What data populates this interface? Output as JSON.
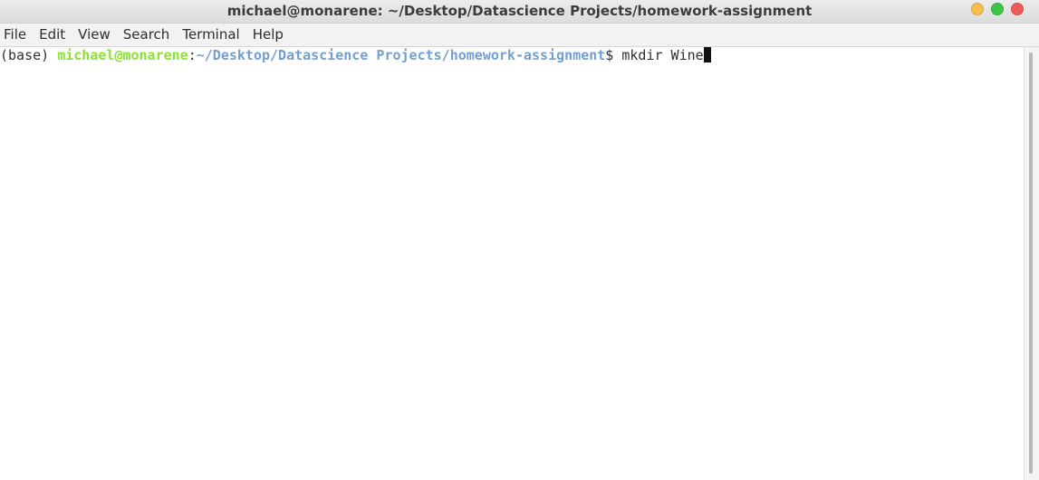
{
  "window": {
    "title": "michael@monarene: ~/Desktop/Datascience Projects/homework-assignment",
    "controls": [
      {
        "name": "minimize",
        "color": "#f4bf4f"
      },
      {
        "name": "maximize",
        "color": "#3cc648"
      },
      {
        "name": "close",
        "color": "#f05b56"
      }
    ]
  },
  "menu": {
    "items": [
      "File",
      "Edit",
      "View",
      "Search",
      "Terminal",
      "Help"
    ]
  },
  "terminal": {
    "prompt": {
      "env": "(base) ",
      "user_host": "michael@monarene",
      "separator": ":",
      "path": "~/Desktop/Datascience Projects/homework-assignment",
      "dollar": "$ "
    },
    "command": "mkdir Wine"
  },
  "colors": {
    "user_host": "#8ae234",
    "path": "#729fcf",
    "text": "#2e2e2e",
    "background": "#ffffff"
  }
}
